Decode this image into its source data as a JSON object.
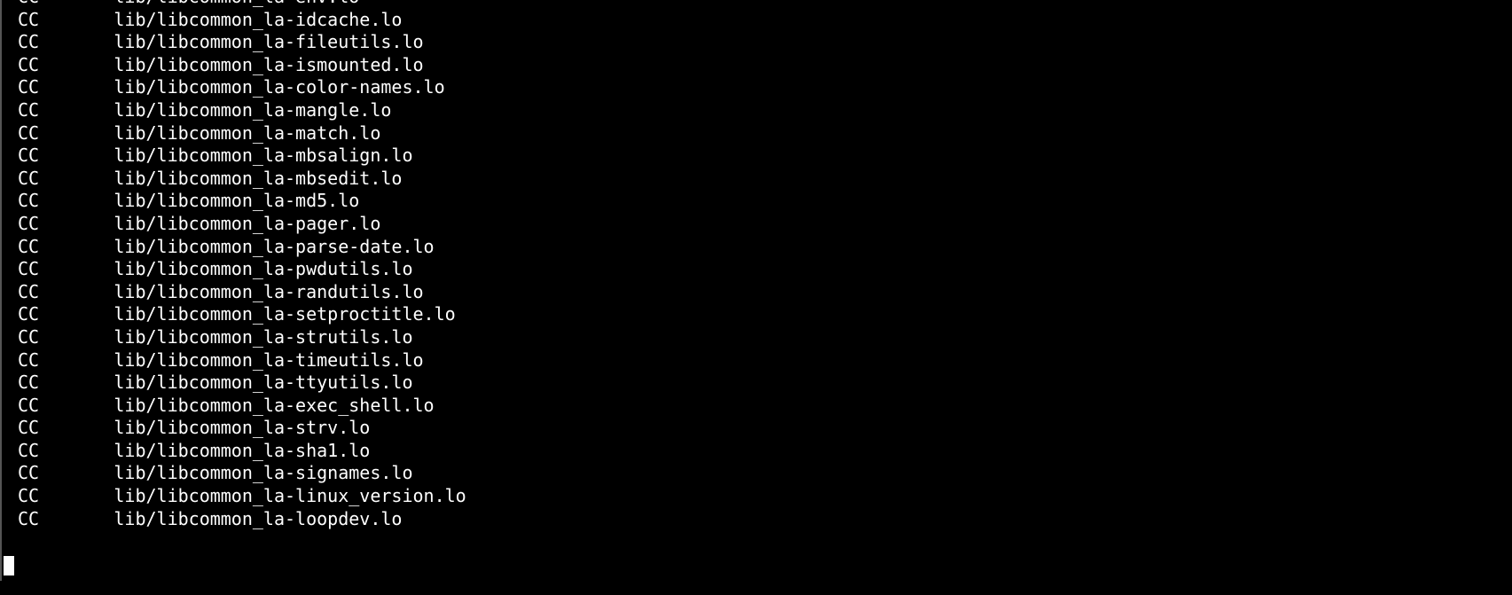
{
  "terminal": {
    "lines": [
      {
        "label": "CC",
        "file": "lib/libcommon_la-env.lo"
      },
      {
        "label": "CC",
        "file": "lib/libcommon_la-idcache.lo"
      },
      {
        "label": "CC",
        "file": "lib/libcommon_la-fileutils.lo"
      },
      {
        "label": "CC",
        "file": "lib/libcommon_la-ismounted.lo"
      },
      {
        "label": "CC",
        "file": "lib/libcommon_la-color-names.lo"
      },
      {
        "label": "CC",
        "file": "lib/libcommon_la-mangle.lo"
      },
      {
        "label": "CC",
        "file": "lib/libcommon_la-match.lo"
      },
      {
        "label": "CC",
        "file": "lib/libcommon_la-mbsalign.lo"
      },
      {
        "label": "CC",
        "file": "lib/libcommon_la-mbsedit.lo"
      },
      {
        "label": "CC",
        "file": "lib/libcommon_la-md5.lo"
      },
      {
        "label": "CC",
        "file": "lib/libcommon_la-pager.lo"
      },
      {
        "label": "CC",
        "file": "lib/libcommon_la-parse-date.lo"
      },
      {
        "label": "CC",
        "file": "lib/libcommon_la-pwdutils.lo"
      },
      {
        "label": "CC",
        "file": "lib/libcommon_la-randutils.lo"
      },
      {
        "label": "CC",
        "file": "lib/libcommon_la-setproctitle.lo"
      },
      {
        "label": "CC",
        "file": "lib/libcommon_la-strutils.lo"
      },
      {
        "label": "CC",
        "file": "lib/libcommon_la-timeutils.lo"
      },
      {
        "label": "CC",
        "file": "lib/libcommon_la-ttyutils.lo"
      },
      {
        "label": "CC",
        "file": "lib/libcommon_la-exec_shell.lo"
      },
      {
        "label": "CC",
        "file": "lib/libcommon_la-strv.lo"
      },
      {
        "label": "CC",
        "file": "lib/libcommon_la-sha1.lo"
      },
      {
        "label": "CC",
        "file": "lib/libcommon_la-signames.lo"
      },
      {
        "label": "CC",
        "file": "lib/libcommon_la-linux_version.lo"
      },
      {
        "label": "CC",
        "file": "lib/libcommon_la-loopdev.lo"
      }
    ]
  }
}
